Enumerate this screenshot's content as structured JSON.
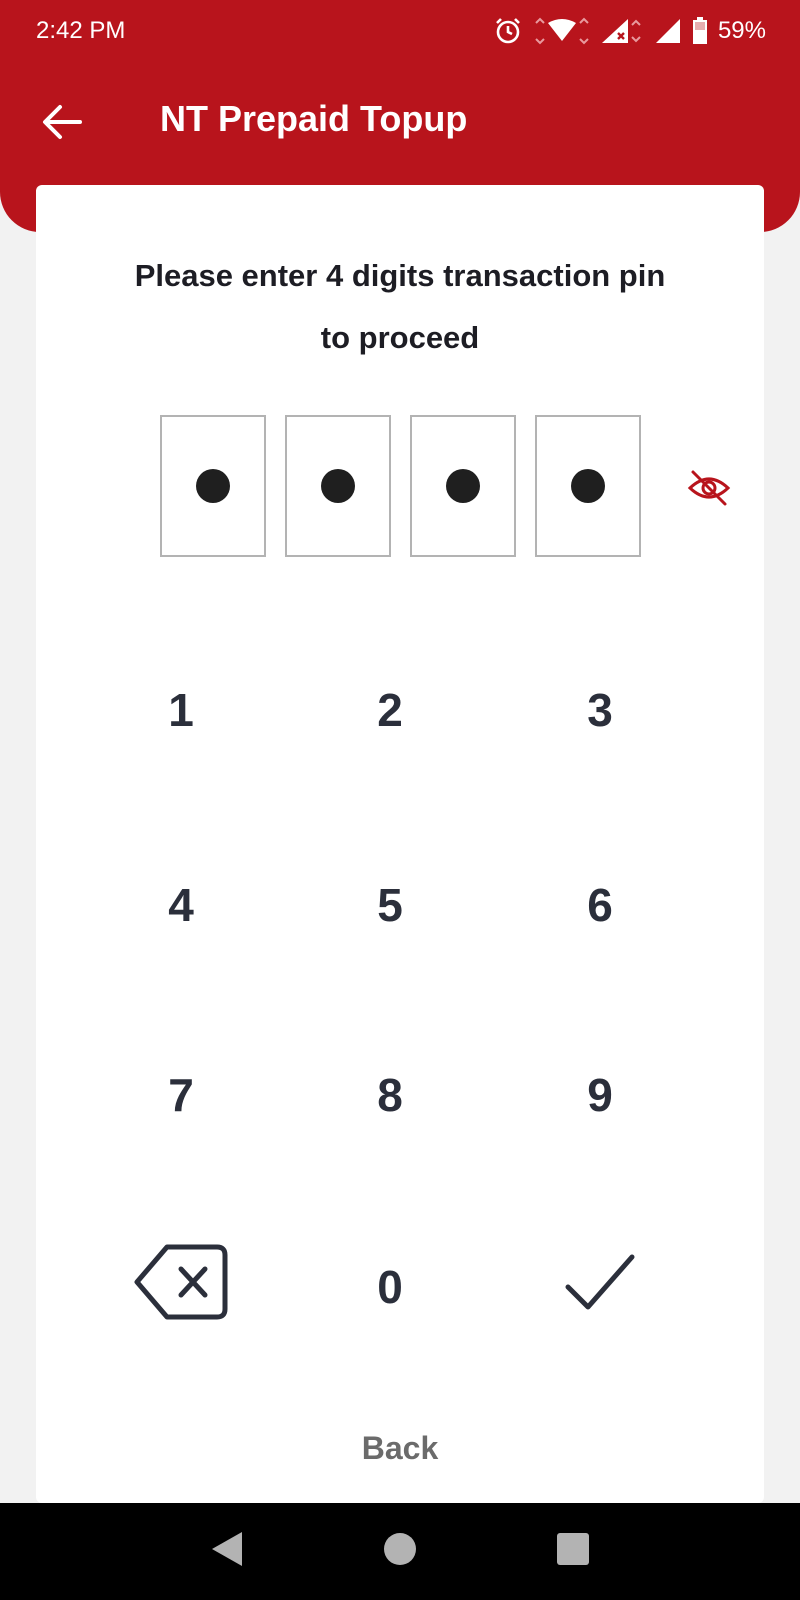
{
  "status_bar": {
    "time": "2:42 PM",
    "battery": "59%",
    "icons": [
      "alarm-icon",
      "wifi-icon",
      "signal-icon",
      "signal-icon",
      "battery-icon"
    ]
  },
  "header": {
    "title": "NT Prepaid Topup",
    "back_icon": "arrow-left-icon"
  },
  "pin": {
    "prompt_line1": "Please enter 4 digits transaction pin",
    "prompt_line2": "to proceed",
    "digits_entered": 4,
    "length": 4,
    "visibility_icon": "eye-off-icon"
  },
  "keypad": {
    "keys": [
      "1",
      "2",
      "3",
      "4",
      "5",
      "6",
      "7",
      "8",
      "9",
      "0"
    ],
    "delete_icon": "backspace-icon",
    "confirm_icon": "check-icon"
  },
  "back_label": "Back",
  "colors": {
    "brand_red": "#b8141c",
    "key_text": "#2b2f3b",
    "dot": "#1f1f1f"
  }
}
